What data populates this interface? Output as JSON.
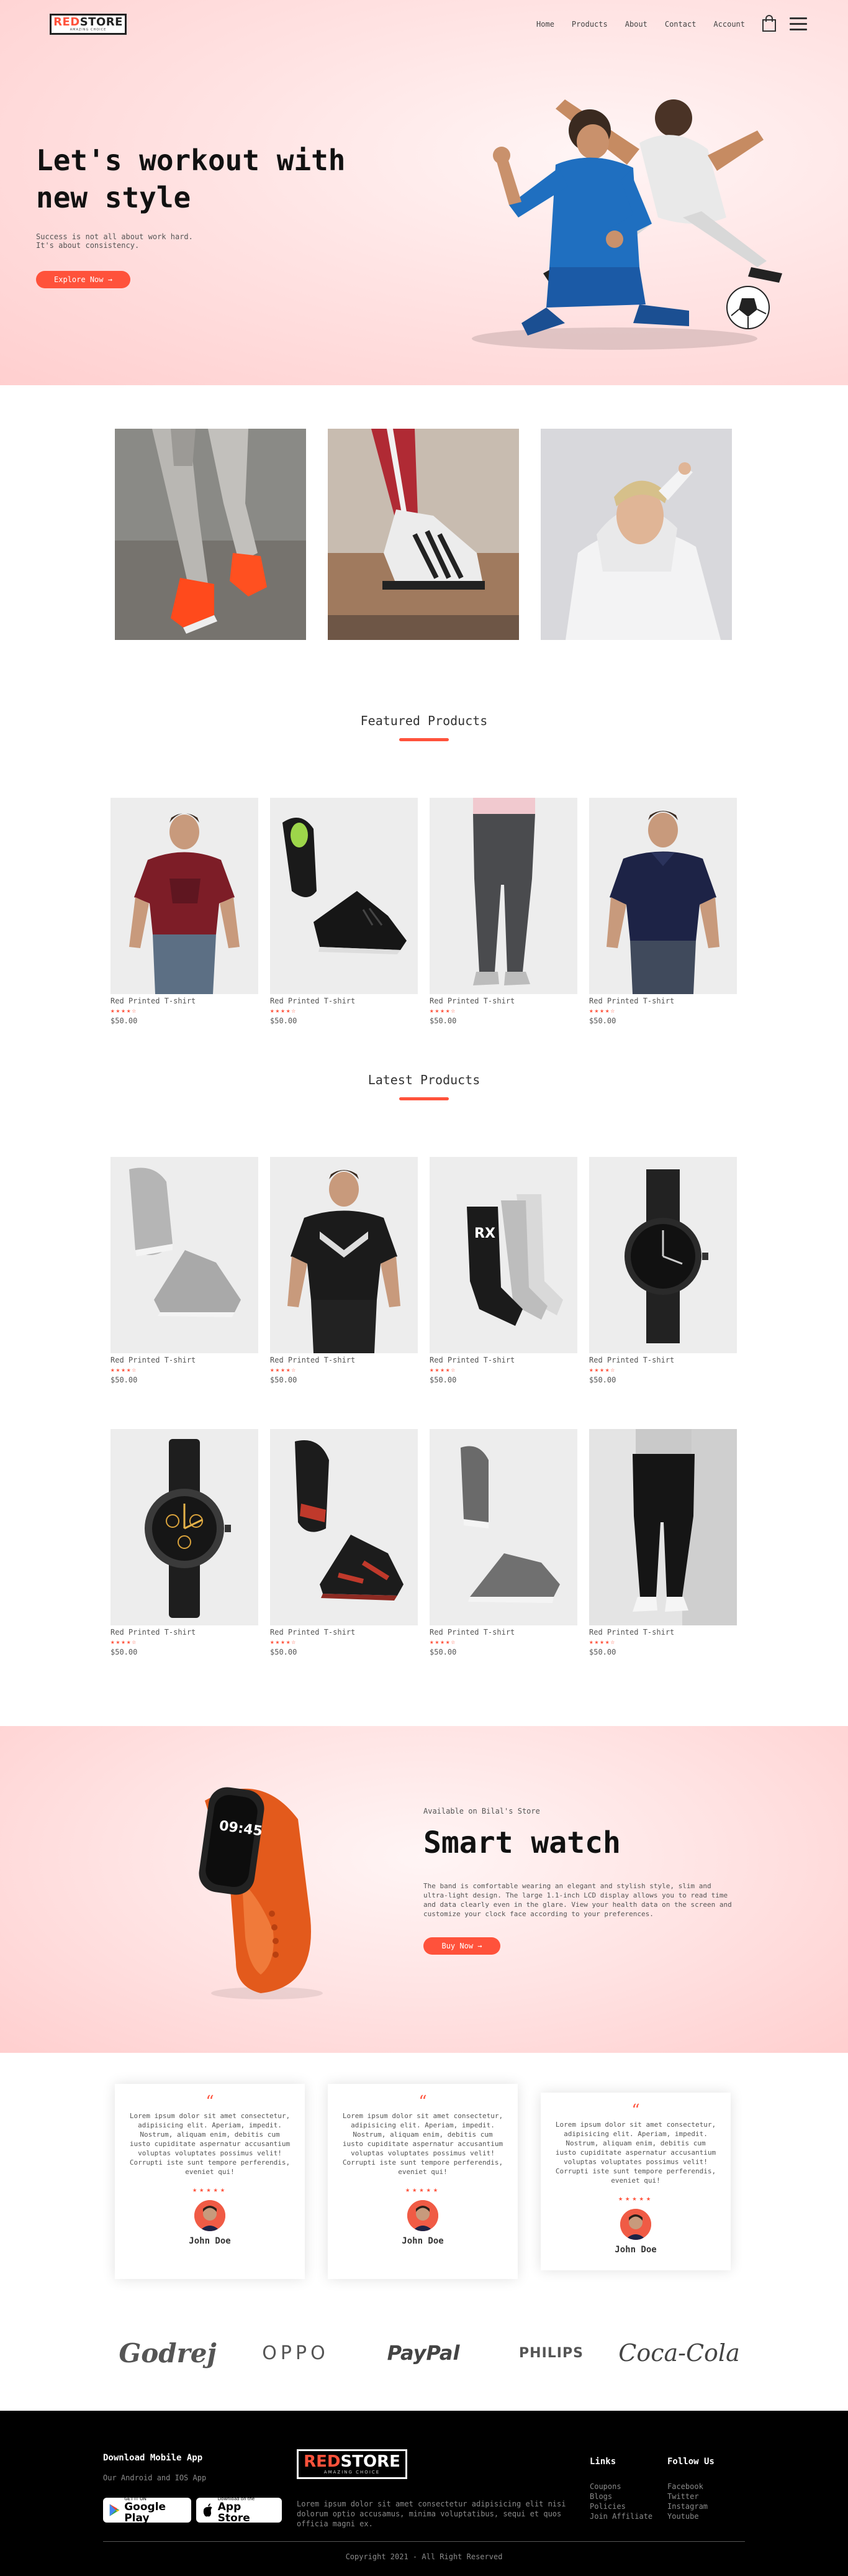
{
  "brand": {
    "logo_red": "RED",
    "logo_black": "STORE",
    "logo_tagline": "AMAZING CHOICE"
  },
  "nav": {
    "home": "Home",
    "products": "Products",
    "about": "About",
    "contact": "Contact",
    "account": "Account"
  },
  "hero": {
    "title": "Let's workout with new style",
    "subtitle_line1": "Success is not all about work hard.",
    "subtitle_line2": "It's about consistency.",
    "button": "Explore Now →"
  },
  "featured": {
    "title": "Featured Products",
    "products": [
      {
        "name": "Red Printed T-shirt",
        "stars": "★★★★☆",
        "price": "$50.00"
      },
      {
        "name": "Red Printed T-shirt",
        "stars": "★★★★☆",
        "price": "$50.00"
      },
      {
        "name": "Red Printed T-shirt",
        "stars": "★★★★☆",
        "price": "$50.00"
      },
      {
        "name": "Red Printed T-shirt",
        "stars": "★★★★☆",
        "price": "$50.00"
      }
    ]
  },
  "latest": {
    "title": "Latest Products",
    "products": [
      {
        "name": "Red Printed T-shirt",
        "stars": "★★★★☆",
        "price": "$50.00"
      },
      {
        "name": "Red Printed T-shirt",
        "stars": "★★★★☆",
        "price": "$50.00"
      },
      {
        "name": "Red Printed T-shirt",
        "stars": "★★★★☆",
        "price": "$50.00"
      },
      {
        "name": "Red Printed T-shirt",
        "stars": "★★★★☆",
        "price": "$50.00"
      },
      {
        "name": "Red Printed T-shirt",
        "stars": "★★★★☆",
        "price": "$50.00"
      },
      {
        "name": "Red Printed T-shirt",
        "stars": "★★★★☆",
        "price": "$50.00"
      },
      {
        "name": "Red Printed T-shirt",
        "stars": "★★★★☆",
        "price": "$50.00"
      },
      {
        "name": "Red Printed T-shirt",
        "stars": "★★★★☆",
        "price": "$50.00"
      }
    ]
  },
  "offer": {
    "small": "Available on Bilal's Store",
    "title": "Smart watch",
    "description": "The band is comfortable wearing an elegant and stylish style, slim and ultra-light design. The large 1.1-inch LCD display allows you to read time and data clearly even in the glare. View your health data on the screen and customize your clock face according to your preferences.",
    "button": "Buy Now →",
    "watch_time": "09:45"
  },
  "testimonials": [
    {
      "quote_mark": "“",
      "text": "Lorem ipsum dolor sit amet consectetur, adipisicing elit. Aperiam, impedit. Nostrum, aliquam enim, debitis cum iusto cupiditate aspernatur accusantium voluptas voluptates possimus velit! Corrupti iste sunt tempore perferendis, eveniet qui!",
      "stars": "★★★★★",
      "name": "John Doe"
    },
    {
      "quote_mark": "“",
      "text": "Lorem ipsum dolor sit amet consectetur, adipisicing elit. Aperiam, impedit. Nostrum, aliquam enim, debitis cum iusto cupiditate aspernatur accusantium voluptas voluptates possimus velit! Corrupti iste sunt tempore perferendis, eveniet qui!",
      "stars": "★★★★★",
      "name": "John Doe"
    },
    {
      "quote_mark": "“",
      "text": "Lorem ipsum dolor sit amet consectetur, adipisicing elit. Aperiam, impedit. Nostrum, aliquam enim, debitis cum iusto cupiditate aspernatur accusantium voluptas voluptates possimus velit! Corrupti iste sunt tempore perferendis, eveniet qui!",
      "stars": "★★★★★",
      "name": "John Doe"
    }
  ],
  "brands": [
    "Godrej",
    "OPPO",
    "PayPal",
    "PHILIPS",
    "Coca-Cola"
  ],
  "footer": {
    "download_title": "Download Mobile App",
    "download_sub": "Our Android and IOS App",
    "google_small": "GET IT ON",
    "google_big": "Google Play",
    "apple_small": "Download on the",
    "apple_big": "App Store",
    "about_text": "Lorem ipsum dolor sit amet consectetur adipisicing elit nisi dolorum optio accusamus, minima voluptatibus, sequi et quos officia magni ex.",
    "links_title": "Links",
    "links": [
      "Coupons",
      "Blogs",
      "Policies",
      "Join Affiliate"
    ],
    "follow_title": "Follow Us",
    "follow": [
      "Facebook",
      "Twitter",
      "Instagram",
      "Youtube"
    ],
    "copyright": "Copyright 2021 - All Right Reserved"
  },
  "colors": {
    "accent": "#ff523b",
    "hero_bg": "#ffd6d6",
    "footer_bg": "#000000"
  }
}
